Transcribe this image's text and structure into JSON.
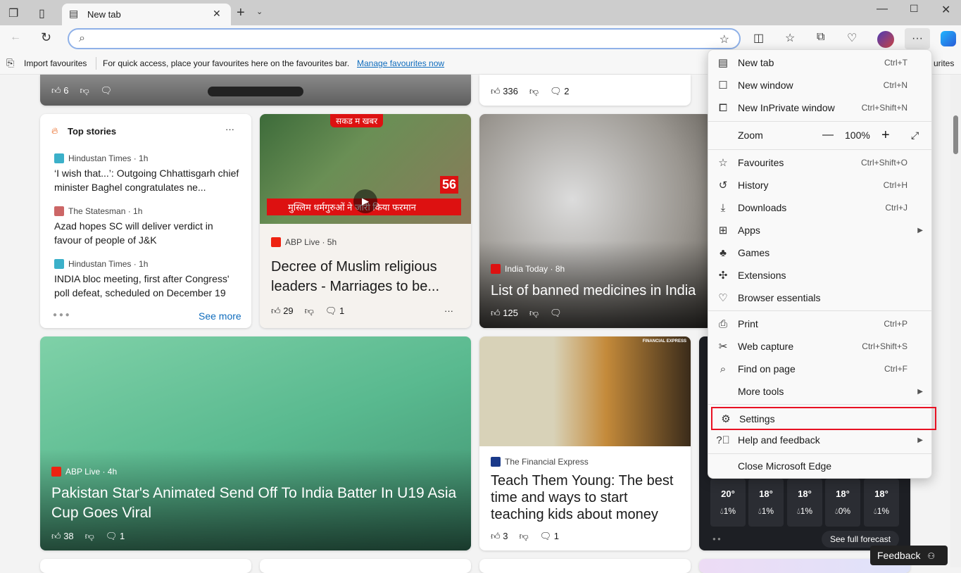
{
  "tab": {
    "title": "New tab"
  },
  "favbar": {
    "import": "Import favourites",
    "hint": "For quick access, place your favourites here on the favourites bar.",
    "manage": "Manage favourites now",
    "right_clip": "urites"
  },
  "hero": {
    "likes": "6"
  },
  "card_top2": {
    "likes": "336",
    "comments": "2"
  },
  "top_stories": {
    "heading": "Top stories",
    "see_more": "See more",
    "items": [
      {
        "source": "Hindustan Times · 1h",
        "title": "‘I wish that...’: Outgoing Chhattisgarh chief minister Baghel congratulates ne..."
      },
      {
        "source": "The Statesman · 1h",
        "title": "Azad hopes SC will deliver verdict in favour of people of J&K"
      },
      {
        "source": "Hindustan Times · 1h",
        "title": "INDIA bloc meeting, first after Congress' poll defeat, scheduled on December 19"
      }
    ]
  },
  "abp1": {
    "banner": "सकड म खबर",
    "overlay": "मुस्लिम धर्मगुरुओं ने जारी किया फरमान",
    "badge": "56",
    "source": "ABP Live · 5h",
    "title": "Decree of Muslim religious leaders - Marriages to be...",
    "likes": "29",
    "comments": "1"
  },
  "india_today": {
    "source": "India Today · 8h",
    "title": "List of banned medicines in India",
    "likes": "125"
  },
  "abp2": {
    "source": "ABP Live · 4h",
    "title": "Pakistan Star's Animated Send Off To India Batter In U19 Asia Cup Goes Viral",
    "likes": "38",
    "comments": "1"
  },
  "fe": {
    "brand": "FINANCIAL EXPRESS",
    "source": "The Financial Express",
    "title": "Teach Them Young: The best time and ways to start teaching kids about money",
    "likes": "3",
    "comments": "1"
  },
  "weather": {
    "days": [
      {
        "t": "20°",
        "p": "1%"
      },
      {
        "t": "18°",
        "p": "1%"
      },
      {
        "t": "18°",
        "p": "1%"
      },
      {
        "t": "18°",
        "p": "0%"
      },
      {
        "t": "18°",
        "p": "1%"
      }
    ],
    "forecast": "See full forecast"
  },
  "feedback": "Feedback",
  "menu": {
    "new_tab": {
      "label": "New tab",
      "sc": "Ctrl+T"
    },
    "new_window": {
      "label": "New window",
      "sc": "Ctrl+N"
    },
    "inprivate": {
      "label": "New InPrivate window",
      "sc": "Ctrl+Shift+N"
    },
    "zoom": {
      "label": "Zoom",
      "value": "100%"
    },
    "favourites": {
      "label": "Favourites",
      "sc": "Ctrl+Shift+O"
    },
    "history": {
      "label": "History",
      "sc": "Ctrl+H"
    },
    "downloads": {
      "label": "Downloads",
      "sc": "Ctrl+J"
    },
    "apps": {
      "label": "Apps"
    },
    "games": {
      "label": "Games"
    },
    "extensions": {
      "label": "Extensions"
    },
    "essentials": {
      "label": "Browser essentials"
    },
    "print": {
      "label": "Print",
      "sc": "Ctrl+P"
    },
    "capture": {
      "label": "Web capture",
      "sc": "Ctrl+Shift+S"
    },
    "find": {
      "label": "Find on page",
      "sc": "Ctrl+F"
    },
    "more": {
      "label": "More tools"
    },
    "settings": {
      "label": "Settings"
    },
    "help": {
      "label": "Help and feedback"
    },
    "close": {
      "label": "Close Microsoft Edge"
    }
  },
  "colors": {
    "accent": "#0f6cbd",
    "highlight": "#e81123"
  }
}
